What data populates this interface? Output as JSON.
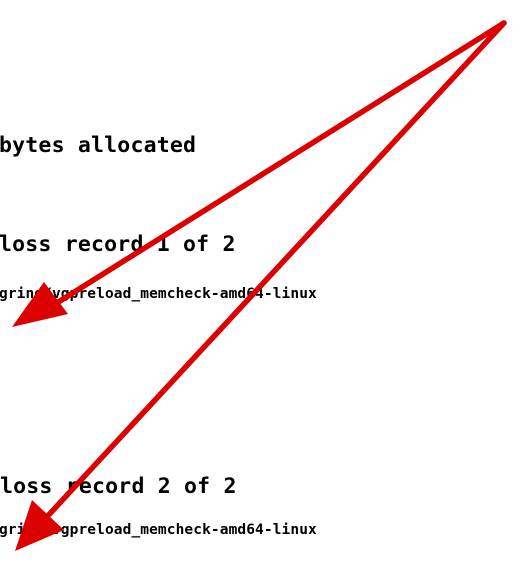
{
  "terminal": {
    "lines": [
      "bytes allocated",
      "loss record 1 of 2",
      "grind/vgpreload_memcheck-amd64-linux",
      "loss record 2 of 2",
      "grind/vgpreload_memcheck-amd64-linux"
    ]
  },
  "annotation": {
    "arrow_color": "#dd0000"
  }
}
